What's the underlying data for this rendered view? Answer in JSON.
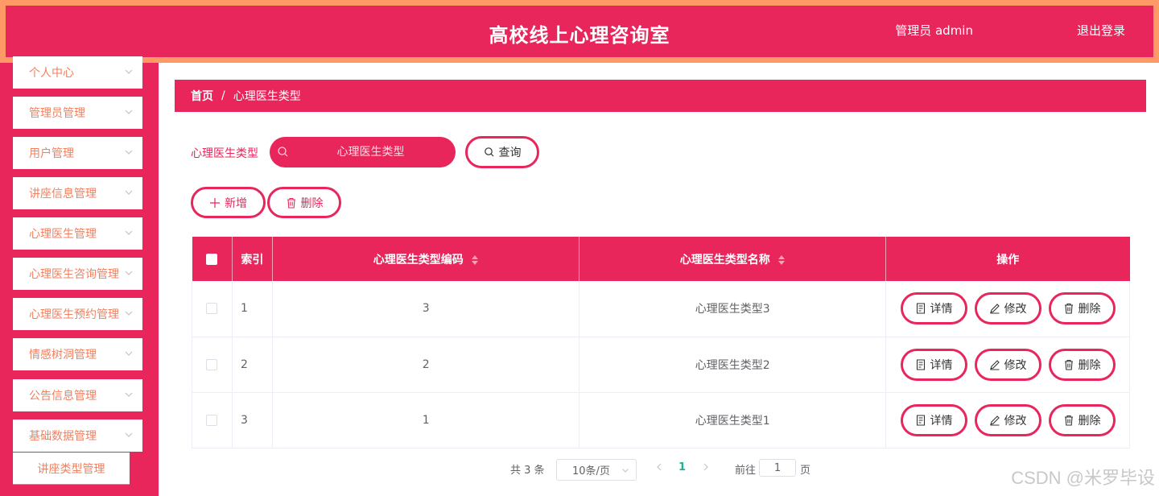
{
  "header": {
    "title": "高校线上心理咨询室",
    "user": "管理员 admin",
    "logout": "退出登录"
  },
  "sidebar": {
    "items": [
      {
        "label": "个人中心"
      },
      {
        "label": "管理员管理"
      },
      {
        "label": "用户管理"
      },
      {
        "label": "讲座信息管理"
      },
      {
        "label": "心理医生管理"
      },
      {
        "label": "心理医生咨询管理"
      },
      {
        "label": "心理医生预约管理"
      },
      {
        "label": "情感树洞管理"
      },
      {
        "label": "公告信息管理"
      },
      {
        "label": "基础数据管理"
      }
    ],
    "sub_item": "讲座类型管理"
  },
  "breadcrumb": {
    "home": "首页",
    "separator": "/",
    "current": "心理医生类型"
  },
  "search": {
    "label": "心理医生类型",
    "placeholder": "心理医生类型",
    "button": "查询"
  },
  "actions": {
    "add": "新增",
    "delete": "删除"
  },
  "table": {
    "headers": {
      "index": "索引",
      "code": "心理医生类型编码",
      "name": "心理医生类型名称",
      "ops": "操作"
    },
    "rows": [
      {
        "index": "1",
        "code": "3",
        "name": "心理医生类型3"
      },
      {
        "index": "2",
        "code": "2",
        "name": "心理医生类型2"
      },
      {
        "index": "3",
        "code": "1",
        "name": "心理医生类型1"
      }
    ],
    "ops": {
      "detail": "详情",
      "edit": "修改",
      "delete": "删除"
    }
  },
  "pagination": {
    "total": "共 3 条",
    "page_size": "10条/页",
    "current_page": "1",
    "goto_label": "前往",
    "goto_value": "1",
    "goto_unit": "页"
  },
  "watermark": "CSDN @米罗毕设",
  "colors": {
    "primary": "#e8265c",
    "header_border": "#ff9966",
    "menu_text": "#f08060",
    "active_page": "#1bb394"
  }
}
